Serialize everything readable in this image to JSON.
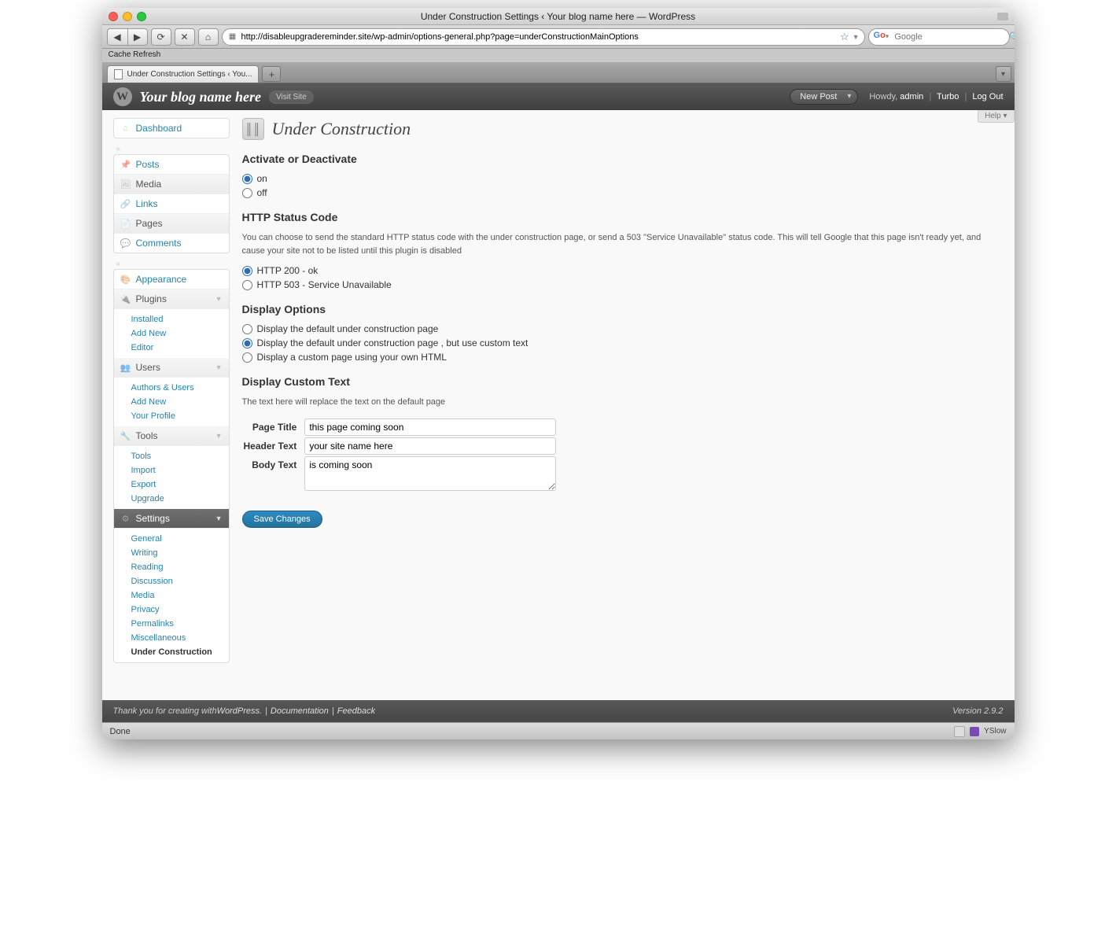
{
  "browser": {
    "window_title": "Under Construction Settings ‹ Your blog name here — WordPress",
    "url": "http://disableupgradereminder.site/wp-admin/options-general.php?page=underConstructionMainOptions",
    "bookmark_bar": "Cache Refresh",
    "tab_title": "Under Construction Settings ‹ You...",
    "search_placeholder": "Google",
    "status_text": "Done",
    "yslow_label": "YSlow"
  },
  "header": {
    "site_name": "Your blog name here",
    "visit_site": "Visit Site",
    "new_post": "New Post",
    "howdy": "Howdy,",
    "user": "admin",
    "turbo": "Turbo",
    "logout": "Log Out",
    "help": "Help"
  },
  "sidebar": {
    "dashboard": "Dashboard",
    "posts": "Posts",
    "media": "Media",
    "links": "Links",
    "pages": "Pages",
    "comments": "Comments",
    "appearance": "Appearance",
    "plugins": "Plugins",
    "plugins_sub": [
      "Installed",
      "Add New",
      "Editor"
    ],
    "users": "Users",
    "users_sub": [
      "Authors & Users",
      "Add New",
      "Your Profile"
    ],
    "tools": "Tools",
    "tools_sub": [
      "Tools",
      "Import",
      "Export",
      "Upgrade"
    ],
    "settings": "Settings",
    "settings_sub": [
      "General",
      "Writing",
      "Reading",
      "Discussion",
      "Media",
      "Privacy",
      "Permalinks",
      "Miscellaneous",
      "Under Construction"
    ]
  },
  "page": {
    "title": "Under Construction",
    "sections": {
      "activate": {
        "heading": "Activate or Deactivate",
        "opt_on": "on",
        "opt_off": "off"
      },
      "http": {
        "heading": "HTTP Status Code",
        "desc": "You can choose to send the standard HTTP status code with the under construction page, or send a 503 \"Service Unavailable\" status code. This will tell Google that this page isn't ready yet, and cause your site not to be listed until this plugin is disabled",
        "opt_200": "HTTP 200 - ok",
        "opt_503": "HTTP 503 - Service Unavailable"
      },
      "display": {
        "heading": "Display Options",
        "opt_default": "Display the default under construction page",
        "opt_custom_text": "Display the default under construction page , but use custom text",
        "opt_custom_html": "Display a custom page using your own HTML"
      },
      "custom_text": {
        "heading": "Display Custom Text",
        "desc": "The text here will replace the text on the default page",
        "page_title_label": "Page Title",
        "page_title_value": "this page coming soon",
        "header_label": "Header Text",
        "header_value": "your site name here",
        "body_label": "Body Text",
        "body_value": "is coming soon"
      }
    },
    "save_button": "Save Changes"
  },
  "footer": {
    "thanks_pre": "Thank you for creating with ",
    "wp": "WordPress",
    "documentation": "Documentation",
    "feedback": "Feedback",
    "version": "Version 2.9.2"
  }
}
